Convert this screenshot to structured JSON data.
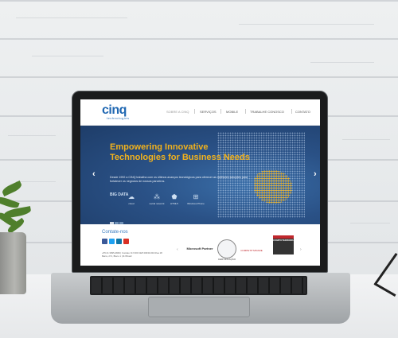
{
  "site": {
    "logo": "cinq",
    "logo_tagline": "technologies",
    "nav": [
      "SOBRE A CINQ",
      "SERVIÇOS",
      "MOBILE",
      "TRABALHE CONOSCO",
      "CONTATO"
    ],
    "hero": {
      "title_line1": "Empowering Innovative",
      "title_line2": "Technologies for Business Needs",
      "body": "Desde 1992 a CINQ trabalha com os últimos avanços tecnológicos para oferecer as melhores soluções para fortalecer os negócios de nossos parceiros.",
      "features": [
        "BIG DATA",
        "cloud",
        "social network",
        "HTML5",
        "Windows Phone"
      ],
      "prev": "‹",
      "next": "›"
    },
    "footer": {
      "contact_title": "Contate-nos",
      "address": "+55 21 3095-4849 | Contato: RJ 300 CEP 20030-004 Rua 18 Barra, 271, Bloco 1 | RJ Brasil",
      "partners": [
        "Microsoft Partner",
        "CERTIFICAÇÃO",
        "COMPETITIVIDADE",
        "COMPUTERWORLD"
      ],
      "prev": "‹",
      "next": "›"
    }
  },
  "colors": {
    "brand_blue": "#1f67b2",
    "hero_accent": "#f2b21c",
    "hero_bg": "#2a5186"
  }
}
